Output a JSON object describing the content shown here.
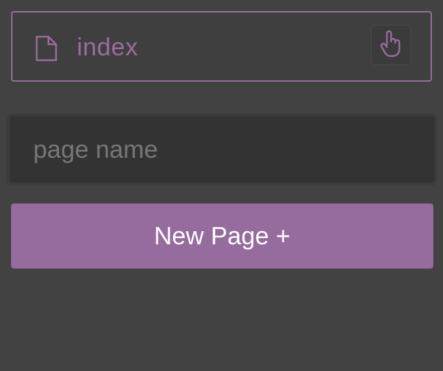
{
  "pages": [
    {
      "label": "index",
      "icon": "file-icon",
      "action_icon": "pointer-hand-icon"
    }
  ],
  "new_page": {
    "input_placeholder": "page name",
    "input_value": "",
    "button_label": "New Page +"
  },
  "colors": {
    "background": "#424242",
    "accent": "#966b9d",
    "accent_text": "#9b6ba0",
    "input_background": "#333333",
    "input_border": "#3a3c3e",
    "placeholder": "#777777",
    "button_text": "#ffffff"
  }
}
